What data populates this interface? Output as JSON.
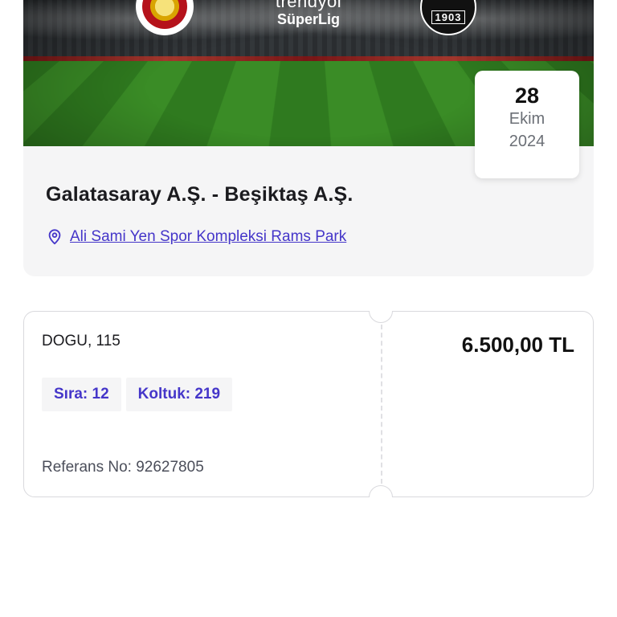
{
  "event": {
    "banner": {
      "league_line1": "trendyol",
      "league_line2": "SüperLig",
      "home_logo_icon": "galatasaray-crest-icon",
      "away_logo_icon": "besiktas-crest-icon",
      "away_logo_year": "1903"
    },
    "date": {
      "day": "28",
      "month": "Ekim",
      "year": "2024"
    },
    "title": "Galatasaray A.Ş. - Beşiktaş A.Ş.",
    "venue": {
      "icon": "location-pin-icon",
      "label": "Ali Sami Yen Spor Kompleksi Rams Park"
    }
  },
  "ticket": {
    "section": "DOGU, 115",
    "price": "6.500,00 TL",
    "chips": [
      {
        "label": "Sıra: 12"
      },
      {
        "label": "Koltuk: 219"
      }
    ],
    "reference": "Referans No: 92627805"
  },
  "colors": {
    "accent": "#4536c9",
    "card_background": "#f5f5f6",
    "border": "#d9d9dd"
  }
}
